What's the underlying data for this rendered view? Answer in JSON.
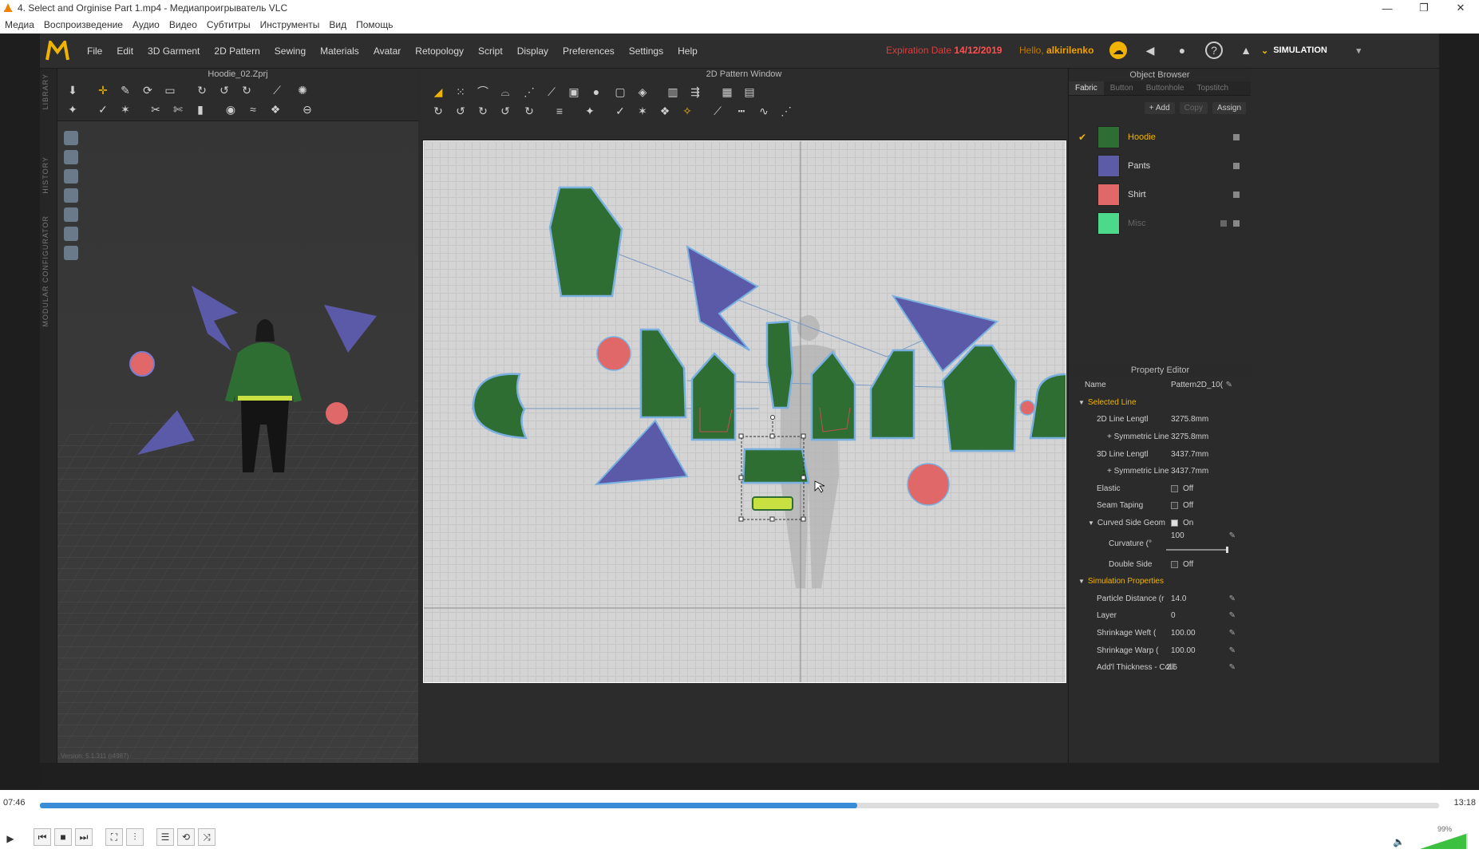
{
  "vlc": {
    "window_title": "4. Select and Orginise Part 1.mp4 - Медиапроигрыватель VLC",
    "menu": [
      "Медиа",
      "Воспроизведение",
      "Аудио",
      "Видео",
      "Субтитры",
      "Инструменты",
      "Вид",
      "Помощь"
    ],
    "time_elapsed": "07:46",
    "time_total": "13:18",
    "progress": 0.584,
    "volume_label": "99%"
  },
  "md": {
    "menu": [
      "File",
      "Edit",
      "3D Garment",
      "2D Pattern",
      "Sewing",
      "Materials",
      "Avatar",
      "Retopology",
      "Script",
      "Display",
      "Preferences",
      "Settings",
      "Help"
    ],
    "expiration_label": "Expiration Date",
    "expiration_date": "14/12/2019",
    "hello_label": "Hello,",
    "user": "alkirilenko",
    "simulation_label": "SIMULATION",
    "left_strip": [
      "LIBRARY",
      "HISTORY",
      "MODULAR CONFIGURATOR"
    ],
    "pane3d_title": "Hoodie_02.Zprj",
    "pane2d_title": "2D Pattern Window",
    "version": "Version: 5.1.311 (r4987)",
    "colors": {
      "accent": "#f0b400",
      "pattern_green": "#2e6b30",
      "pattern_blue": "#5a5aa8",
      "pattern_red": "#e06060",
      "misc_green": "#4dd98a"
    }
  },
  "object_browser": {
    "title": "Object Browser",
    "tabs": [
      "Fabric",
      "Button",
      "Buttonhole",
      "Topstitch"
    ],
    "actions": {
      "add": "+ Add",
      "copy": "Copy",
      "assign": "Assign"
    },
    "fabrics": [
      {
        "name": "Hoodie",
        "color": "#2f6e33",
        "selected": true
      },
      {
        "name": "Pants",
        "color": "#5c5ca6",
        "selected": false
      },
      {
        "name": "Shirt",
        "color": "#e06868",
        "selected": false
      },
      {
        "name": "Misc",
        "color": "#4dd98a",
        "selected": false
      }
    ]
  },
  "property_editor": {
    "title": "Property Editor",
    "name_label": "Name",
    "name_value": "Pattern2D_10(",
    "selected_line_label": "Selected Line",
    "rows": [
      {
        "label": "2D Line Lengtl",
        "value": "3275.8mm"
      },
      {
        "label": "+ Symmetric Line",
        "value": "3275.8mm"
      },
      {
        "label": "3D Line Lengtl",
        "value": "3437.7mm"
      },
      {
        "label": "+ Symmetric Line",
        "value": "3437.7mm"
      }
    ],
    "elastic_label": "Elastic",
    "elastic_value": "Off",
    "seam_taping_label": "Seam Taping",
    "seam_taping_value": "Off",
    "curved_side_label": "Curved Side Geom",
    "curved_side_value": "On",
    "curvature_label": "Curvature (°",
    "curvature_value": "100",
    "double_side_label": "Double Side",
    "double_side_value": "Off",
    "sim_props_label": "Simulation Properties",
    "sim_rows": [
      {
        "label": "Particle Distance (r",
        "value": "14.0"
      },
      {
        "label": "Layer",
        "value": "0"
      },
      {
        "label": "Shrinkage Weft (",
        "value": "100.00"
      },
      {
        "label": "Shrinkage Warp (",
        "value": "100.00"
      },
      {
        "label": "Add'l Thickness - Colli",
        "value": "2.5"
      }
    ]
  }
}
